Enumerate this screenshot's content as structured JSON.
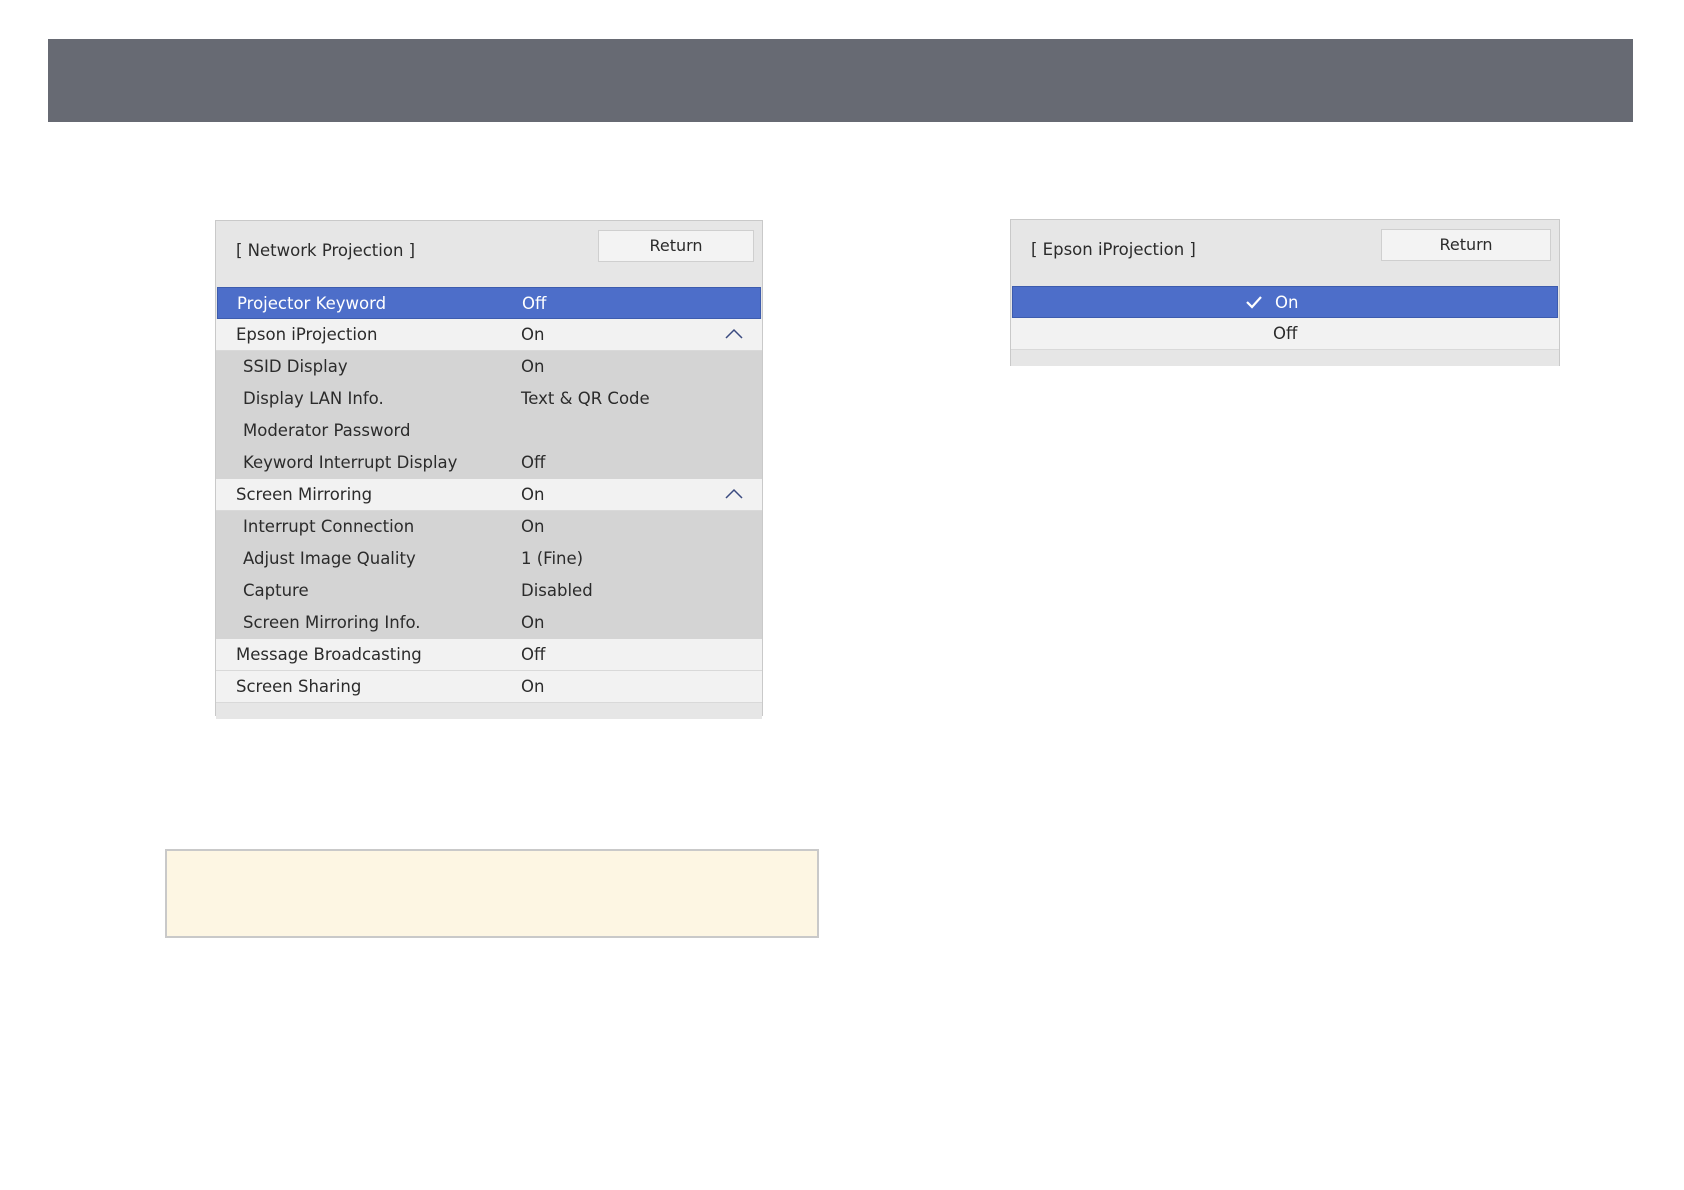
{
  "colors": {
    "top_band": "#676a73",
    "selected_row": "#4d6ec9",
    "note_box": "#fdf6e3"
  },
  "network_projection": {
    "title": "[ Network Projection ]",
    "return_label": "Return",
    "rows": [
      {
        "label": "Projector Keyword",
        "value": "Off",
        "selected": true
      },
      {
        "label": "Epson iProjection",
        "value": "On",
        "expand_icon": "chevron-up-icon"
      },
      {
        "label": "SSID Display",
        "value": "On"
      },
      {
        "label": "Display LAN Info.",
        "value": "Text & QR Code"
      },
      {
        "label": "Moderator Password",
        "value": ""
      },
      {
        "label": "Keyword Interrupt Display",
        "value": "Off"
      },
      {
        "label": "Screen Mirroring",
        "value": "On",
        "expand_icon": "chevron-up-icon"
      },
      {
        "label": "Interrupt Connection",
        "value": "On"
      },
      {
        "label": "Adjust Image Quality",
        "value": "1 (Fine)"
      },
      {
        "label": "Capture",
        "value": "Disabled"
      },
      {
        "label": "Screen Mirroring Info.",
        "value": "On"
      },
      {
        "label": "Message Broadcasting",
        "value": "Off"
      },
      {
        "label": "Screen Sharing",
        "value": "On"
      }
    ]
  },
  "epson_iprojection": {
    "title": "[ Epson iProjection ]",
    "return_label": "Return",
    "options": [
      {
        "label": "On",
        "checked": true,
        "icon": "checkmark-icon"
      },
      {
        "label": "Off",
        "checked": false
      }
    ]
  }
}
